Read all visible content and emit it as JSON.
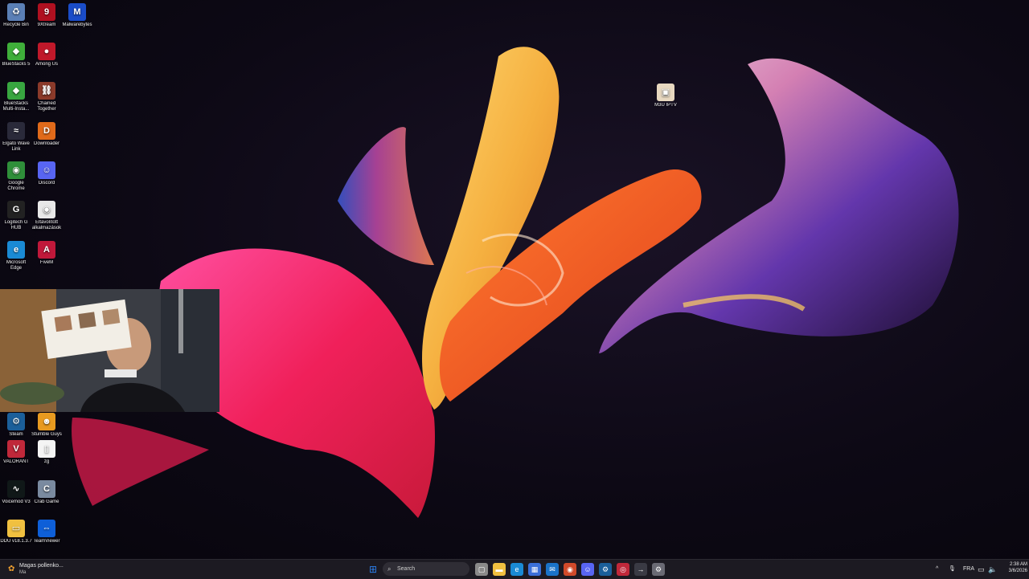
{
  "desktop": {
    "icons": [
      {
        "label": "Recycle Bin",
        "icon": "recycle-bin-icon",
        "color": "#5b7fb6",
        "glyph": "♻"
      },
      {
        "label": "9Xtream",
        "icon": "9xtream-icon",
        "color": "#b01020",
        "glyph": "9"
      },
      {
        "label": "Malwarebytes",
        "icon": "malwarebytes-icon",
        "color": "#1a4cc8",
        "glyph": "M"
      },
      {
        "label": "BlueStacks 5",
        "icon": "bluestacks-icon",
        "color": "#3fae3a",
        "glyph": "◆"
      },
      {
        "label": "Among Us",
        "icon": "among-us-icon",
        "color": "#c0182a",
        "glyph": "●"
      },
      {
        "label": "BlueStacks\nMulti-Insta...",
        "icon": "bluestacks-multi-icon",
        "color": "#38a640",
        "glyph": "◆"
      },
      {
        "label": "Chained\nTogether",
        "icon": "chained-together-icon",
        "color": "#8b3a2a",
        "glyph": "⛓"
      },
      {
        "label": "Elgato Wave\nLink",
        "icon": "elgato-wave-link-icon",
        "color": "#2a2a3a",
        "glyph": "≈"
      },
      {
        "label": "Downloader",
        "icon": "downloader-icon",
        "color": "#e06a1a",
        "glyph": "D"
      },
      {
        "label": "Google\nChrome",
        "icon": "chrome-icon",
        "color": "#2f8f3a",
        "glyph": "◉"
      },
      {
        "label": "Discord",
        "icon": "discord-icon",
        "color": "#5865f2",
        "glyph": "☺"
      },
      {
        "label": "Logitech G\nHUB",
        "icon": "logitech-ghub-icon",
        "color": "#222222",
        "glyph": "G"
      },
      {
        "label": "Eltávolított\nalkalmazások",
        "icon": "removed-apps-icon",
        "color": "#e8e8e8",
        "glyph": "◉"
      },
      {
        "label": "Microsoft\nEdge",
        "icon": "edge-icon",
        "color": "#1a8ad4",
        "glyph": "e"
      },
      {
        "label": "FiveM",
        "icon": "fivem-icon",
        "color": "#c0183a",
        "glyph": "A"
      },
      {
        "label": "Steam",
        "icon": "steam-icon",
        "color": "#1b5f9a",
        "glyph": "⚙"
      },
      {
        "label": "Stumble Guys",
        "icon": "stumble-guys-icon",
        "color": "#e89a20",
        "glyph": "☻"
      },
      {
        "label": "VALORANT",
        "icon": "valorant-icon",
        "color": "#c0283a",
        "glyph": "V"
      },
      {
        "label": "zg",
        "icon": "file-icon",
        "color": "#f4f4f4",
        "glyph": "▯"
      },
      {
        "label": "Voicemod V3",
        "icon": "voicemod-icon",
        "color": "#101818",
        "glyph": "∿"
      },
      {
        "label": "Crab Game",
        "icon": "crab-game-icon",
        "color": "#7a8aa0",
        "glyph": "C"
      },
      {
        "label": "DDU v18.1.3.7",
        "icon": "folder-icon",
        "color": "#f0c040",
        "glyph": "▭"
      },
      {
        "label": "TeamViewer",
        "icon": "teamviewer-icon",
        "color": "#0e5fd8",
        "glyph": "⇔"
      },
      {
        "label": "M3U IPTV",
        "icon": "m3u-iptv-icon",
        "color": "#e8d8c0",
        "glyph": "▣"
      }
    ]
  },
  "taskbar": {
    "weather": {
      "title": "Magas pollenko...",
      "subtitle": "Ma"
    },
    "search_placeholder": "Search",
    "apps": [
      {
        "name": "start-button",
        "glyph": "⊞",
        "color": "#2b7de9"
      },
      {
        "name": "task-view-button",
        "glyph": "▢",
        "color": "#8a8a8a"
      },
      {
        "name": "file-explorer-button",
        "glyph": "▬",
        "color": "#f0c040"
      },
      {
        "name": "edge-button",
        "glyph": "e",
        "color": "#1a8ad4"
      },
      {
        "name": "store-button",
        "glyph": "▦",
        "color": "#3a6fd8"
      },
      {
        "name": "mail-button",
        "glyph": "✉",
        "color": "#1a73c8"
      },
      {
        "name": "chrome-button",
        "glyph": "◉",
        "color": "#d04a2a"
      },
      {
        "name": "discord-button",
        "glyph": "☺",
        "color": "#5865f2"
      },
      {
        "name": "steam-button",
        "glyph": "⚙",
        "color": "#1b5f9a"
      },
      {
        "name": "app-red-button",
        "glyph": "◎",
        "color": "#c0283a"
      },
      {
        "name": "app-arrow-button",
        "glyph": "→",
        "color": "#3a3a44"
      },
      {
        "name": "settings-button",
        "glyph": "⚙",
        "color": "#6a6a74"
      }
    ],
    "tray": {
      "chevron": "^",
      "mic": "🎙",
      "language": "FRA",
      "clock_time": "2:38 AM",
      "clock_date": "3/6/2026"
    }
  }
}
